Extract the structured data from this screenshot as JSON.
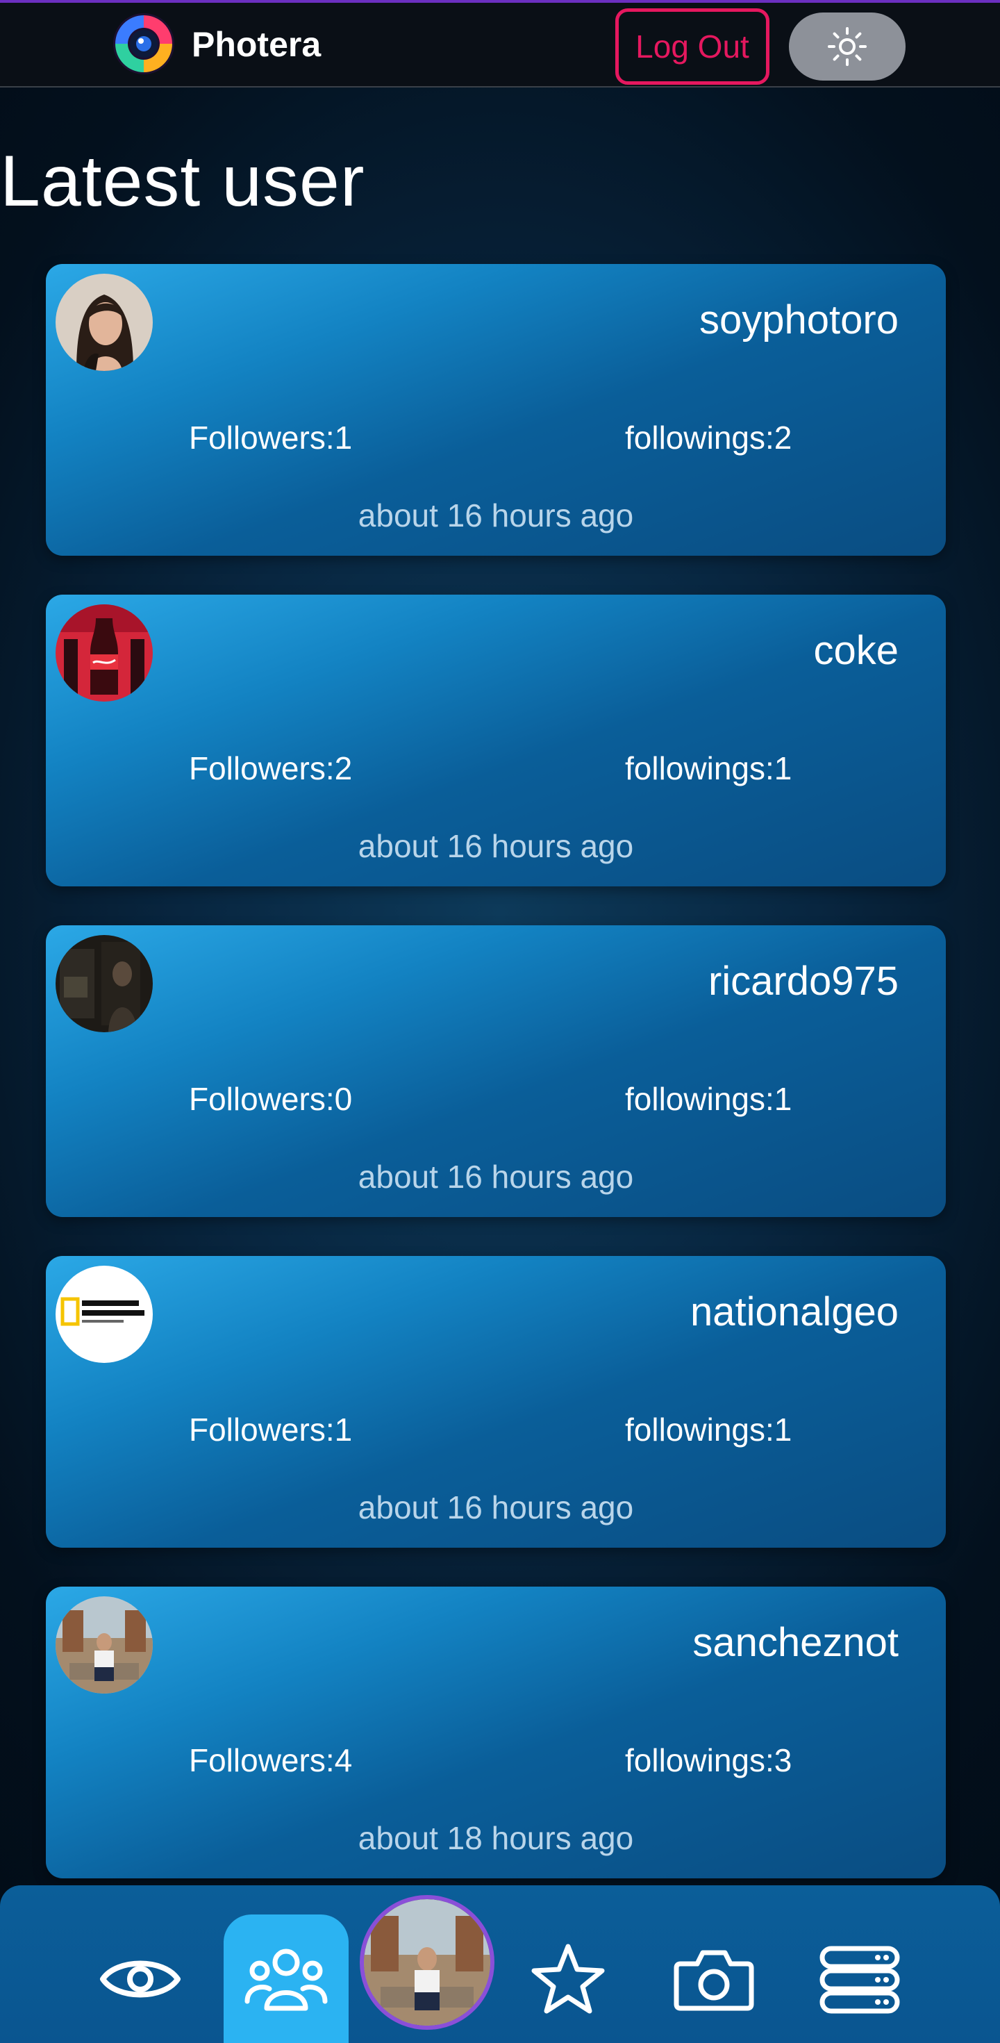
{
  "header": {
    "brand": "Photera",
    "logout_label": "Log Out",
    "theme_toggle_icon": "sun-icon"
  },
  "section": {
    "title": "Latest user"
  },
  "users": [
    {
      "username": "soyphotoro",
      "followers": "Followers:1",
      "followings": "followings:2",
      "time": "about 16 hours ago"
    },
    {
      "username": "coke",
      "followers": "Followers:2",
      "followings": "followings:1",
      "time": "about 16 hours ago"
    },
    {
      "username": "ricardo975",
      "followers": "Followers:0",
      "followings": "followings:1",
      "time": "about 16 hours ago"
    },
    {
      "username": "nationalgeo",
      "followers": "Followers:1",
      "followings": "followings:1",
      "time": "about 16 hours ago"
    },
    {
      "username": "sancheznot",
      "followers": "Followers:4",
      "followings": "followings:3",
      "time": "about 18 hours ago"
    }
  ],
  "nav": {
    "items": [
      "eye-icon",
      "users-icon",
      "profile-avatar",
      "star-icon",
      "camera-icon",
      "database-icon"
    ],
    "active": "users-icon"
  },
  "colors": {
    "logout_accent": "#e5185f",
    "card_gradient_start": "#2ba8e6",
    "card_gradient_end": "#0a4d82",
    "nav_active": "#2bb3f2",
    "profile_ring": "#8a4fd8"
  }
}
